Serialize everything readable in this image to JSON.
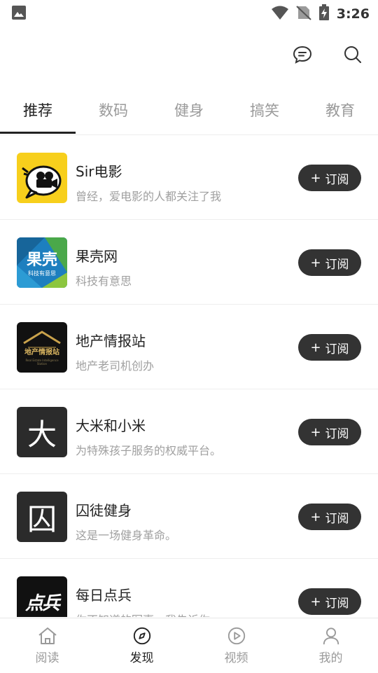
{
  "status_bar": {
    "time": "3:26"
  },
  "tabs": [
    {
      "label": "推荐",
      "active": true
    },
    {
      "label": "数码",
      "active": false
    },
    {
      "label": "健身",
      "active": false
    },
    {
      "label": "搞笑",
      "active": false
    },
    {
      "label": "教育",
      "active": false
    }
  ],
  "subscribe_label": "订阅",
  "subscribe_plus": "+",
  "channels": [
    {
      "name": "Sir电影",
      "desc": "曾经，爱电影的人都关注了我"
    },
    {
      "name": "果壳网",
      "desc": "科技有意思",
      "logo_text": "果壳",
      "logo_sub": "科技有意思"
    },
    {
      "name": "地产情报站",
      "desc": "地产老司机创办",
      "logo_text": "地产情报站",
      "logo_sub": "Real Estate Intelligence Station"
    },
    {
      "name": "大米和小米",
      "desc": "为特殊孩子服务的权威平台。",
      "logo_text": "大"
    },
    {
      "name": "囚徒健身",
      "desc": "这是一场健身革命。",
      "logo_text": "囚"
    },
    {
      "name": "每日点兵",
      "desc": "你不知道的军事，我告诉你",
      "logo_text": "点兵"
    }
  ],
  "bottom_nav": [
    {
      "label": "阅读",
      "icon": "home-icon",
      "active": false
    },
    {
      "label": "发现",
      "icon": "compass-icon",
      "active": true
    },
    {
      "label": "视频",
      "icon": "play-icon",
      "active": false
    },
    {
      "label": "我的",
      "icon": "user-icon",
      "active": false
    }
  ],
  "colors": {
    "accent": "#333333",
    "muted": "#9a9a9a",
    "divider": "#eeeeee"
  }
}
